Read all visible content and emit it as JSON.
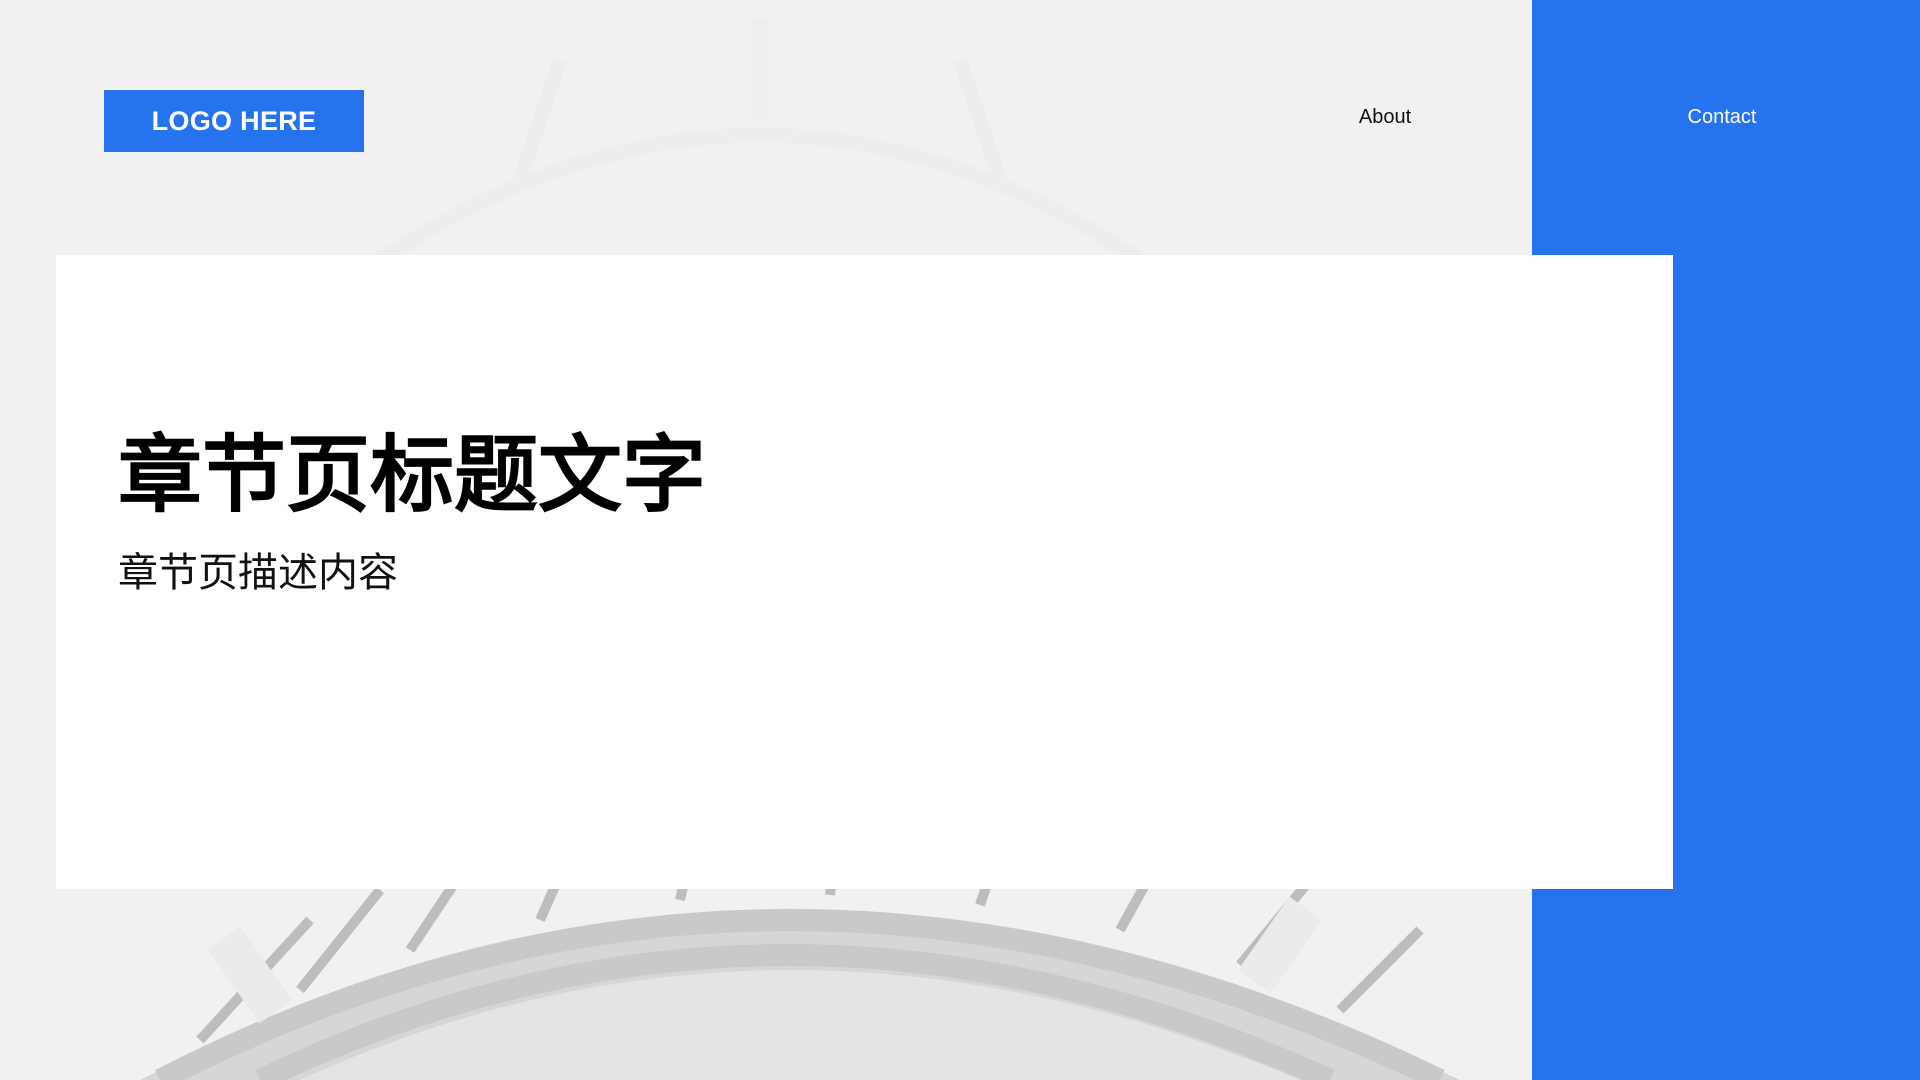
{
  "header": {
    "logo_text": "LOGO HERE",
    "nav": {
      "about_label": "About",
      "contact_label": "Contact"
    }
  },
  "section": {
    "title": "章节页标题文字",
    "description": "章节页描述内容"
  },
  "colors": {
    "accent": "#2673f0",
    "background": "#f1f1f1",
    "card": "#ffffff"
  }
}
